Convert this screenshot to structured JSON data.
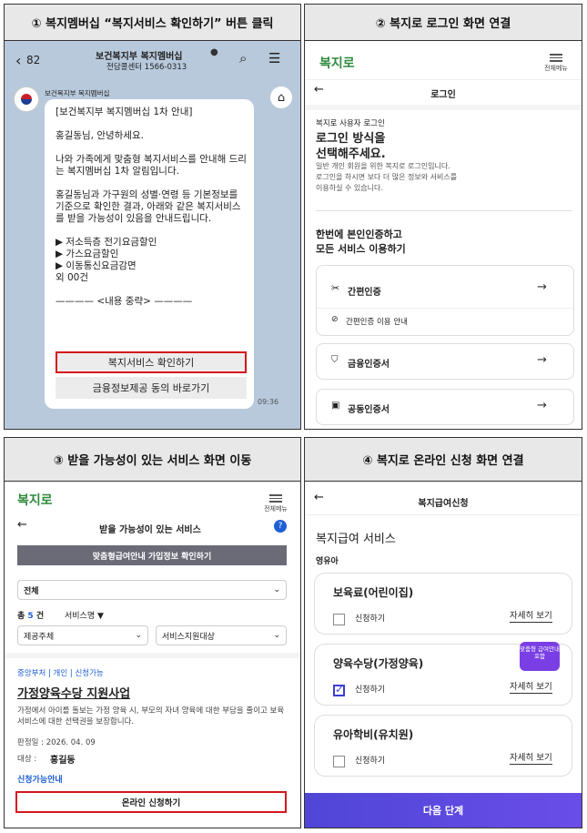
{
  "q1": {
    "header": "① 복지멤버십 “복지서비스 확인하기” 버튼 클릭",
    "back_count": "82",
    "channel_title": "보건복지부 복지멤버십",
    "channel_sub": "전담콜센터 1566-0313",
    "sender": "보건복지부 복지멤버십",
    "message": "[보건복지부 복지멤버십 1차 안내]\n\n홍길동님, 안녕하세요.\n\n나와 가족에게 맞춤형 복지서비스를 안내해 드리는 복지멤버십 1차 알림입니다.\n\n홍길동님과 가구원의 성별·연령 등 기본정보를 기준으로 확인한 결과, 아래와 같은 복지서비스를 받을 가능성이 있음을 안내드립니다.\n\n▶ 저소득층 전기요금할인\n▶ 가스요금할인\n▶ 이동통신요금감면\n외 00건\n\n———— <내용 중략> ————",
    "btn_check": "복지서비스 확인하기",
    "btn_consent": "금융정보제공 동의 바로가기",
    "time": "09:36"
  },
  "q2": {
    "header": "② 복지로 로그인 화면 연결",
    "logo": "복지로",
    "menu_label": "전체메뉴",
    "title": "로그인",
    "small": "복지로 사용자 로그인",
    "big1": "로그인 방식을",
    "big2": "선택해주세요.",
    "desc1": "일반 개인 회원을 위한 복지로 로그인입니다.",
    "desc2": "로그인을 하시면 보다 더 많은 정보와 서비스를",
    "desc3": "이용하실 수 있습니다.",
    "sec1": "한번에 본인인증하고",
    "sec2": "모든 서비스 이용하기",
    "easy_auth": "간편인증",
    "easy_guide": "간편인증 이용 안내",
    "finance_cert": "금융인증서",
    "joint_cert": "공동인증서"
  },
  "q3": {
    "header": "③ 받을 가능성이 있는 서비스 화면 이동",
    "logo": "복지로",
    "menu_label": "전체메뉴",
    "title": "받을 가능성이 있는 서비스",
    "info_btn": "맞춤형급여안내 가입정보 확인하기",
    "sel_all": "전체",
    "count_prefix": "총",
    "count_num": "5",
    "count_suffix": "건",
    "sort": "서비스명 ▼",
    "sel_org": "제공주체",
    "sel_target": "서비스지원대상",
    "tags": "중앙부처 | 개인 | 신청가능",
    "service_title": "가정양육수당 지원사업",
    "service_desc": "가정에서 아이를 돌보는 가정 양육 시, 부모의 자녀 양육에 대한 부담을 줄이고 보육 서비스에 대한 선택권을 보장합니다.",
    "date": "판정일 : 2026. 04. 09",
    "target_label": "대상 :",
    "target_name": "홍길동",
    "apply_guide": "신청가능안내",
    "apply_btn": "온라인 신청하기"
  },
  "q4": {
    "header": "④ 복지로 온라인 신청 화면 연결",
    "title": "복지급여신청",
    "section": "복지급여 서비스",
    "sub": "영유아",
    "items": [
      {
        "name": "보육료(어린이집)",
        "apply": "신청하기",
        "detail": "자세히 보기",
        "checked": false
      },
      {
        "name": "양육수당(가정양육)",
        "apply": "신청하기",
        "detail": "자세히 보기",
        "checked": true
      },
      {
        "name": "유아학비(유치원)",
        "apply": "신청하기",
        "detail": "자세히 보기",
        "checked": false
      }
    ],
    "badge": "맞춤형 급여안내 포함",
    "next": "다음 단계"
  },
  "colors": {
    "accent_red": "#d4161c",
    "purple": "#5b4fe0",
    "green": "#2f8a3c",
    "blue": "#1e5fd6"
  }
}
